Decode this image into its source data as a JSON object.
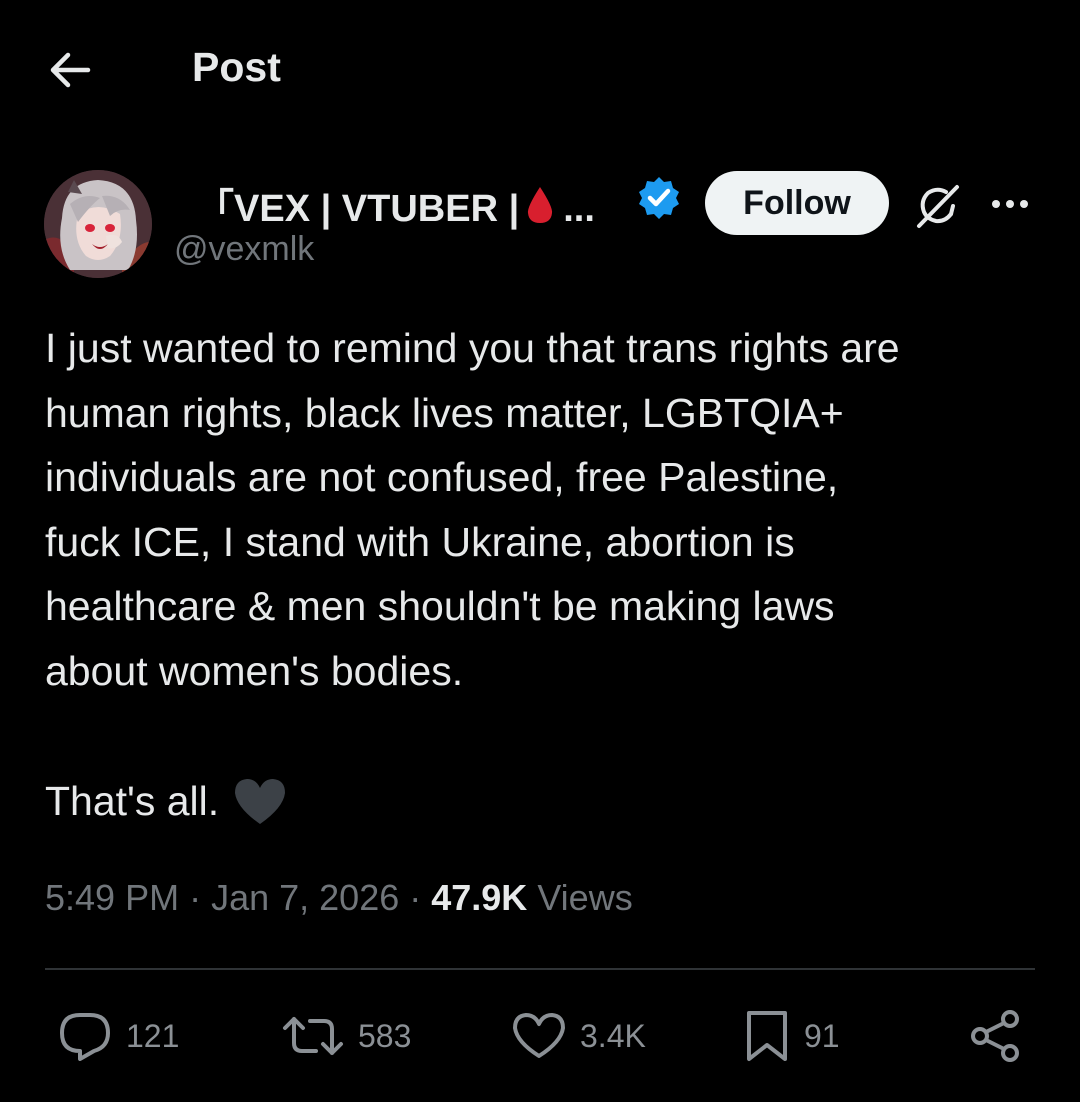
{
  "header": {
    "title": "Post"
  },
  "author": {
    "display_name": "「VEX | VTUBER |",
    "display_name_truncation": "...",
    "handle": "@vexmlk",
    "follow_label": "Follow",
    "verified_color": "#1d9bf0"
  },
  "post": {
    "text": "I just wanted to remind you that trans rights are\nhuman rights, black lives matter, LGBTQIA+\nindividuals are not confused, free Palestine,\nfuck ICE, I stand with Ukraine, abortion is\nhealthcare & men shouldn't be making laws\nabout women's bodies.",
    "closing": "That's all.",
    "closing_emoji": "black-heart"
  },
  "meta": {
    "time": "5:49 PM",
    "sep1": " · ",
    "date": "Jan 7, 2026",
    "sep2": " · ",
    "views_count": "47.9K",
    "views_label": " Views"
  },
  "actions": {
    "replies": "121",
    "reposts": "583",
    "likes": "3.4K",
    "bookmarks": "91"
  },
  "colors": {
    "background": "#000000",
    "text": "#e7e9ea",
    "muted": "#71767b",
    "accent": "#1d9bf0",
    "divider": "#2f3336"
  }
}
